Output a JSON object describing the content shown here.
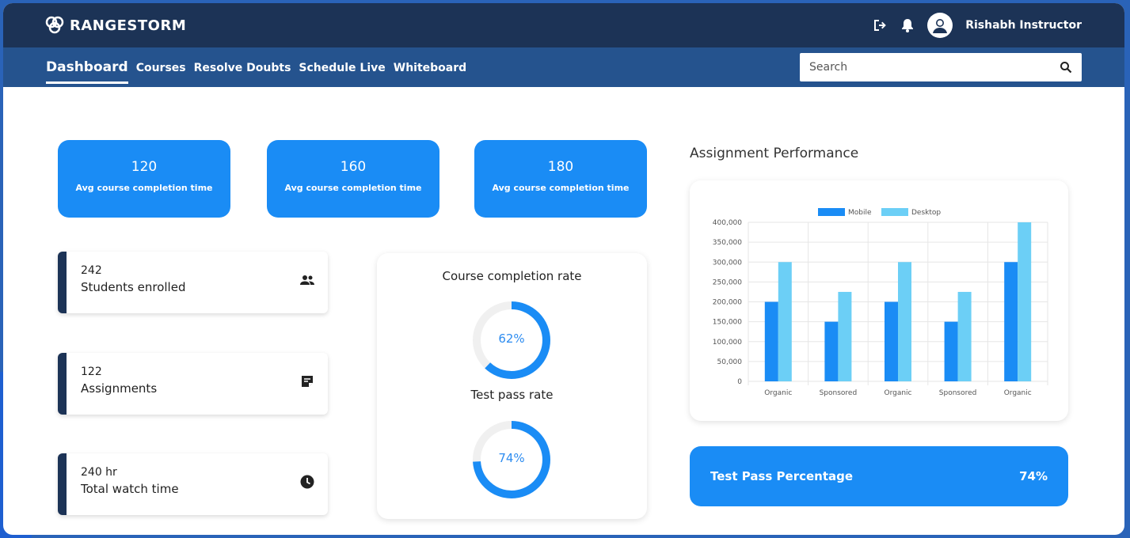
{
  "app": {
    "brand": "RANGESTORM",
    "user_name": "Rishabh Instructor"
  },
  "nav": {
    "items": [
      {
        "label": "Dashboard",
        "active": true
      },
      {
        "label": "Courses",
        "active": false
      },
      {
        "label": "Resolve Doubts",
        "active": false
      },
      {
        "label": "Schedule Live",
        "active": false
      },
      {
        "label": "Whiteboard",
        "active": false
      }
    ],
    "search_placeholder": "Search"
  },
  "stats": [
    {
      "value": "120",
      "label": "Avg course completion time"
    },
    {
      "value": "160",
      "label": "Avg course completion time"
    },
    {
      "value": "180",
      "label": "Avg course completion time"
    }
  ],
  "info_cards": [
    {
      "value": "242",
      "label": "Students enrolled",
      "icon": "people-icon"
    },
    {
      "value": "122",
      "label": "Assignments",
      "icon": "note-icon"
    },
    {
      "value": "240 hr",
      "label": "Total watch time",
      "icon": "clock-icon"
    }
  ],
  "rates": {
    "completion_title": "Course completion rate",
    "completion_value": "62%",
    "completion_fraction": 0.62,
    "pass_title": "Test pass rate",
    "pass_value": "74%",
    "pass_fraction": 0.74
  },
  "performance": {
    "title": "Assignment Performance"
  },
  "test_pass": {
    "label": "Test Pass Percentage",
    "value": "74%"
  },
  "colors": {
    "topbar": "#1c3356",
    "navbar": "#25538e",
    "accent": "#1a8cf5",
    "mobile": "#1a8cf5",
    "desktop": "#6ccff6"
  },
  "chart_data": {
    "type": "bar",
    "categories": [
      "Organic",
      "Sponsored",
      "Organic",
      "Sponsored",
      "Organic"
    ],
    "series": [
      {
        "name": "Mobile",
        "values": [
          200000,
          150000,
          200000,
          150000,
          300000
        ]
      },
      {
        "name": "Desktop",
        "values": [
          300000,
          225000,
          300000,
          225000,
          400000
        ]
      }
    ],
    "ylim": [
      0,
      400000
    ],
    "yticks": [
      "0",
      "50,000",
      "100,000",
      "150,000",
      "200,000",
      "250,000",
      "300,000",
      "350,000",
      "400,000"
    ],
    "legend": "top",
    "grid": true
  }
}
